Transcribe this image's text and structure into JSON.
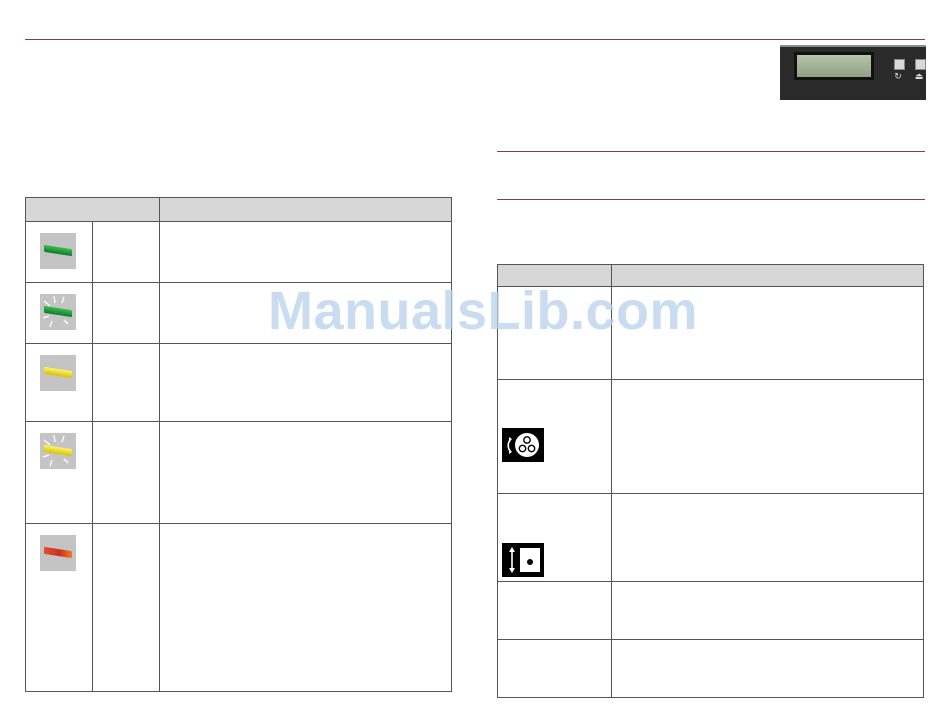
{
  "left_table": {
    "headers": [
      "",
      ""
    ],
    "rows": [
      {
        "led": "green",
        "flashing": false,
        "status": "",
        "description": ""
      },
      {
        "led": "green",
        "flashing": true,
        "status": "",
        "description": ""
      },
      {
        "led": "yellow",
        "flashing": false,
        "status": "",
        "description": ""
      },
      {
        "led": "yellow",
        "flashing": true,
        "status": "",
        "description": ""
      },
      {
        "led": "red",
        "flashing": false,
        "status": "",
        "description": ""
      }
    ]
  },
  "right_table": {
    "headers": [
      "",
      ""
    ],
    "rows": [
      {
        "icon": "",
        "description": ""
      },
      {
        "icon": "rotate-disc-icon",
        "description": ""
      },
      {
        "icon": "eject-disc-icon",
        "description": ""
      },
      {
        "icon": "",
        "description": ""
      },
      {
        "icon": "",
        "description": ""
      }
    ]
  },
  "watermark": "ManualsLib.com",
  "colors": {
    "rule": "#7a3b6e",
    "header_fill": "#d7d7d7",
    "watermark": "#b7d1ec"
  }
}
